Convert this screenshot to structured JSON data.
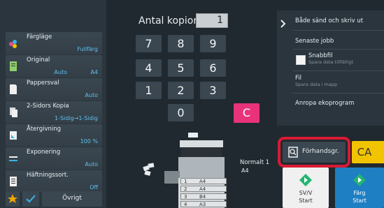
{
  "colors": {
    "accent_blue": "#5fc3f0",
    "clear_key": "#e8337a",
    "highlight_red": "#d81a35",
    "ca_yellow": "#f2c400",
    "color_start_blue": "#1f7fc3"
  },
  "settings": [
    {
      "label": "Färgläge",
      "value": "Fullfärg",
      "icon": "color-mode-icon"
    },
    {
      "label": "Original",
      "value": "A4",
      "value2": "Auto",
      "icon": "original-icon"
    },
    {
      "label": "Pappersval",
      "value": "Auto",
      "icon": "paper-select-icon"
    },
    {
      "label": "2-Sidors Kopia",
      "value": "1-Sidig→1-Sidig",
      "icon": "duplex-icon"
    },
    {
      "label": "Återgivning",
      "value": "100 %",
      "icon": "reproduction-icon"
    },
    {
      "label": "Exponering",
      "value": "Auto",
      "icon": "exposure-icon"
    },
    {
      "label": "Häftningssort.",
      "value": "Off",
      "icon": "staple-sort-icon"
    }
  ],
  "bottom_bar": {
    "other_label": "Övrigt",
    "star_icon": "star-icon",
    "check_icon": "checkmark-icon"
  },
  "keypad": {
    "copies_label": "Antal kopior",
    "copies_value": "1",
    "keys": [
      "7",
      "8",
      "9",
      "4",
      "5",
      "6",
      "1",
      "2",
      "3",
      "0"
    ],
    "clear_label": "C"
  },
  "right_panel": {
    "send_and_print": "Både sänd och skriv ut",
    "recent_jobs": "Senaste jobb",
    "quick_file": "Snabbfil",
    "quick_file_sub": "Spara data tillfälligt",
    "file": "Fil",
    "file_sub": "Spara data i mapp",
    "eco_program": "Anropa ekoprogram"
  },
  "machine": {
    "normal_label": "Normalt 1",
    "normal_size": "A4",
    "trays": [
      {
        "num": "1",
        "size": "A4"
      },
      {
        "num": "2",
        "size": "A4"
      },
      {
        "num": "3",
        "size": "B4"
      },
      {
        "num": "4",
        "size": "A3"
      }
    ]
  },
  "actions": {
    "preview_label": "Förhandsgr.",
    "ca_label": "CA",
    "bw_start_line1": "SV/V",
    "bw_start_line2": "Start",
    "color_start_line1": "Färg",
    "color_start_line2": "Start"
  }
}
